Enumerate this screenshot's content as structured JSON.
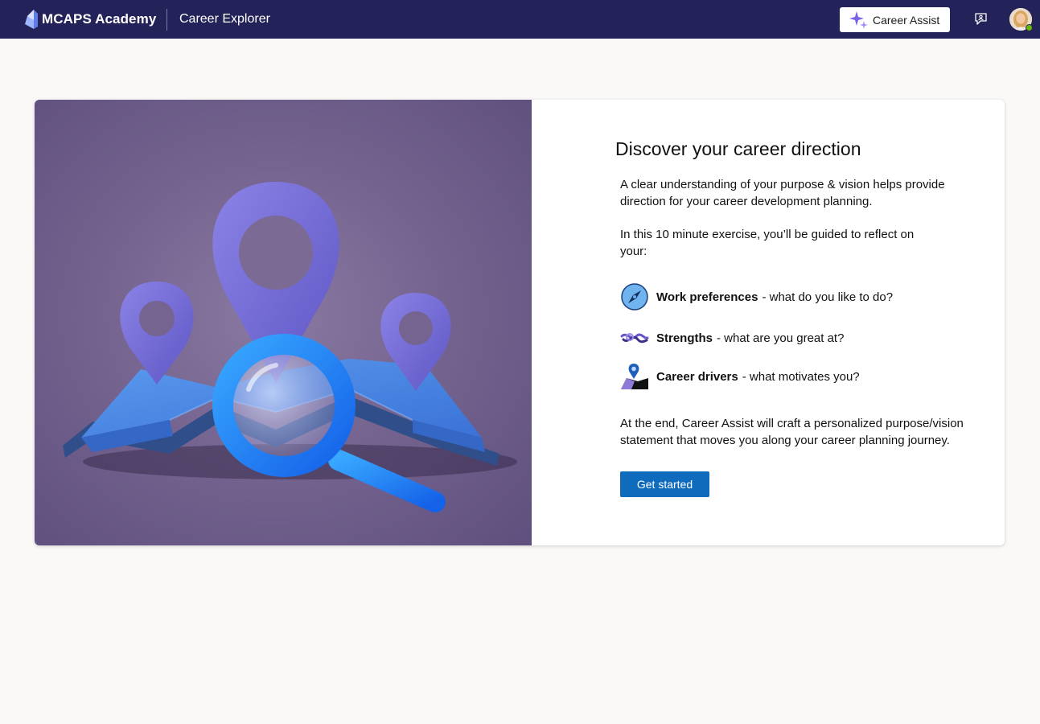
{
  "header": {
    "brand": "MCAPS Academy",
    "app_name": "Career Explorer",
    "assist_label": "Career Assist",
    "bar_color": "#23235a"
  },
  "hero": {
    "accent": "#2f8cff",
    "background": "#75648f"
  },
  "main": {
    "title": "Discover your career direction",
    "intro": "A clear understanding of your purpose & vision helps provide direction for your career development planning.",
    "exercise": "In this 10 minute exercise, you’ll be guided to reflect on your:",
    "items": [
      {
        "label": "Work preferences",
        "desc": "- what do you like to do?",
        "icon": "compass-icon"
      },
      {
        "label": "Strengths",
        "desc": "- what are you great at?",
        "icon": "knot-icon"
      },
      {
        "label": "Career drivers",
        "desc": "- what motivates you?",
        "icon": "map-pin-icon"
      }
    ],
    "outro": "At the end, Career Assist will craft a personalized purpose/vision statement that moves you along your career planning journey.",
    "cta_label": "Get started",
    "cta_color": "#0f6cbd"
  }
}
